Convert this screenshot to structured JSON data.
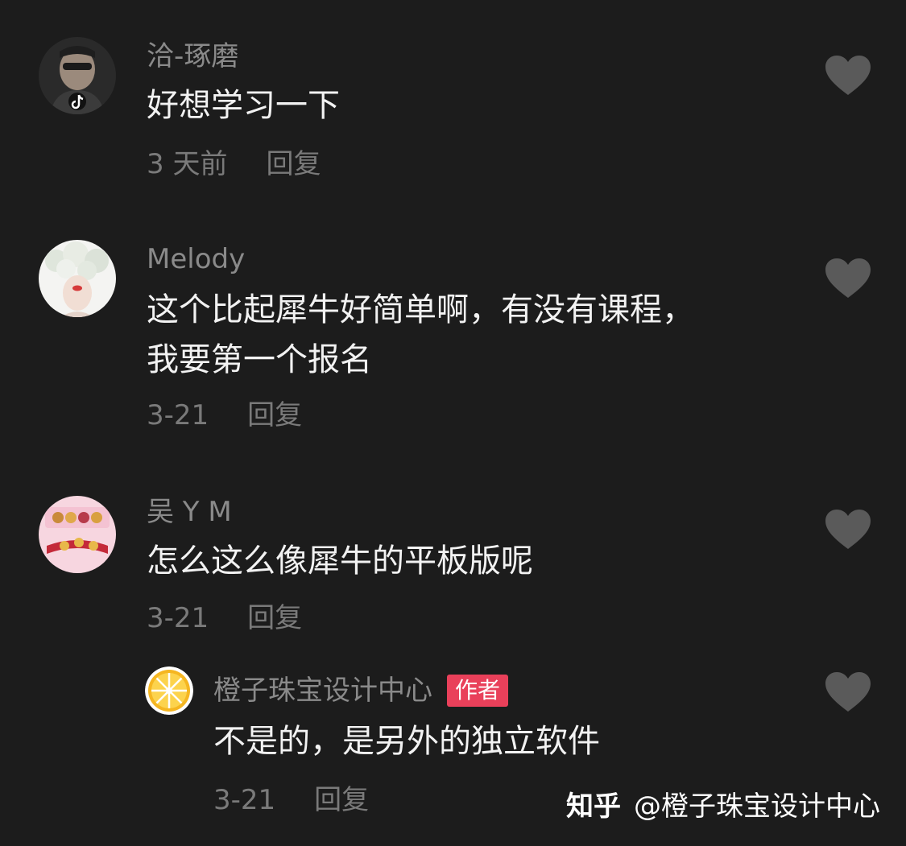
{
  "colors": {
    "background": "#1c1c1c",
    "username": "#8a8a8a",
    "content": "#f2f2f2",
    "meta": "#7a7a7a",
    "like_icon": "#5a5a5a",
    "author_badge": "#e9405a"
  },
  "comments": [
    {
      "username": "洽-琢磨",
      "lines": [
        "好想学习一下"
      ],
      "time": "3 天前",
      "reply_label": "回复",
      "like_icon": "heart-icon"
    },
    {
      "username": "Melody",
      "lines": [
        "这个比起犀牛好简单啊，有没有课程，",
        "我要第一个报名"
      ],
      "time": "3-21",
      "reply_label": "回复",
      "like_icon": "heart-icon"
    },
    {
      "username": "吴 Y M",
      "lines": [
        "怎么这么像犀牛的平板版呢"
      ],
      "time": "3-21",
      "reply_label": "回复",
      "like_icon": "heart-icon"
    }
  ],
  "reply": {
    "username": "橙子珠宝设计中心",
    "badge": "作者",
    "lines": [
      "不是的，是另外的独立软件"
    ],
    "time": "3-21",
    "reply_label": "回复",
    "like_icon": "heart-icon"
  },
  "watermark": {
    "logo": "知乎",
    "handle": "@橙子珠宝设计中心"
  }
}
